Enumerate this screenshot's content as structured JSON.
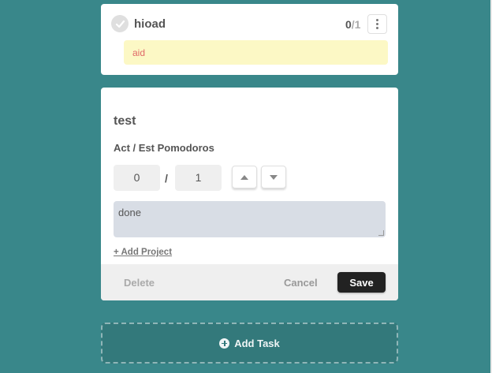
{
  "task_item": {
    "title": "hioad",
    "act": "0",
    "est": "/1",
    "note": "aid"
  },
  "edit": {
    "title": "test",
    "pomodoros_label": "Act / Est Pomodoros",
    "act_value": "0",
    "separator": "/",
    "est_value": "1",
    "notes": "done",
    "add_project": "+ Add Project",
    "delete_label": "Delete",
    "cancel_label": "Cancel",
    "save_label": "Save"
  },
  "add_task_label": "Add Task",
  "icons": {
    "check": "check-icon",
    "menu": "more-vertical-icon",
    "up": "arrow-up-icon",
    "down": "arrow-down-icon",
    "add": "plus-circle-icon"
  },
  "colors": {
    "background": "#39878a",
    "note_bg": "#fcf8c5",
    "note_text": "#e06868",
    "save_bg": "#222222"
  }
}
